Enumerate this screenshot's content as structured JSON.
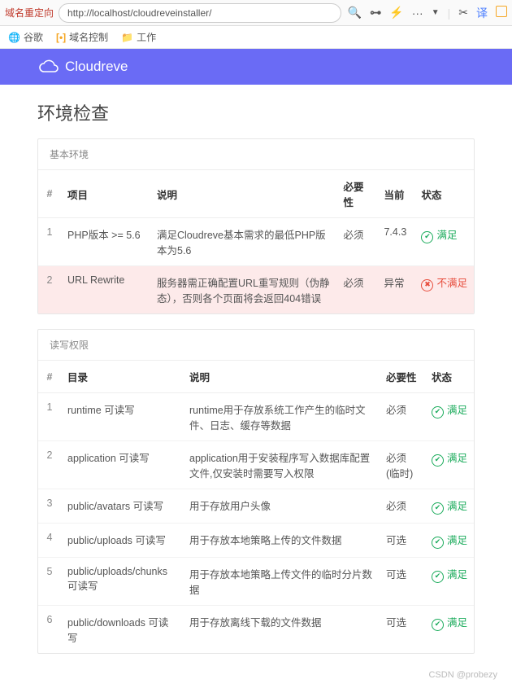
{
  "browser": {
    "tab_label": "域名重定向",
    "url": "http://localhost/cloudreveinstaller/",
    "toolbar_more": "···",
    "bookmarks": [
      {
        "icon": "globe",
        "label": "谷歌"
      },
      {
        "icon": "bracket",
        "label": "域名控制"
      },
      {
        "icon": "folder",
        "label": "工作"
      }
    ]
  },
  "brand": "Cloudreve",
  "page_title": "环境检查",
  "section1": {
    "title": "基本环境",
    "cols": {
      "num": "#",
      "item": "项目",
      "desc": "说明",
      "need": "必要性",
      "cur": "当前",
      "stat": "状态"
    },
    "rows": [
      {
        "n": "1",
        "item": "PHP版本 >= 5.6",
        "desc": "满足Cloudreve基本需求的最低PHP版本为5.6",
        "need": "必须",
        "cur": "7.4.3",
        "stat": "满足",
        "ok": true
      },
      {
        "n": "2",
        "item": "URL Rewrite",
        "desc": "服务器需正确配置URL重写规则（伪静态），否则各个页面将会返回404错误",
        "need": "必须",
        "cur": "异常",
        "stat": "不满足",
        "ok": false
      }
    ]
  },
  "section2": {
    "title": "读写权限",
    "cols": {
      "num": "#",
      "item": "目录",
      "desc": "说明",
      "need": "必要性",
      "stat": "状态"
    },
    "rows": [
      {
        "n": "1",
        "item": "runtime 可读写",
        "desc": "runtime用于存放系统工作产生的临时文件、日志、缓存等数据",
        "need": "必须",
        "stat": "满足"
      },
      {
        "n": "2",
        "item": "application 可读写",
        "desc": "application用于安装程序写入数据库配置文件,仅安装时需要写入权限",
        "need": "必须(临时)",
        "stat": "满足"
      },
      {
        "n": "3",
        "item": "public/avatars 可读写",
        "desc": "用于存放用户头像",
        "need": "必须",
        "stat": "满足"
      },
      {
        "n": "4",
        "item": "public/uploads 可读写",
        "desc": "用于存放本地策略上传的文件数据",
        "need": "可选",
        "stat": "满足"
      },
      {
        "n": "5",
        "item": "public/uploads/chunks 可读写",
        "desc": "用于存放本地策略上传文件的临时分片数据",
        "need": "可选",
        "stat": "满足"
      },
      {
        "n": "6",
        "item": "public/downloads 可读写",
        "desc": "用于存放离线下载的文件数据",
        "need": "可选",
        "stat": "满足"
      }
    ]
  },
  "watermark": "CSDN @probezy"
}
